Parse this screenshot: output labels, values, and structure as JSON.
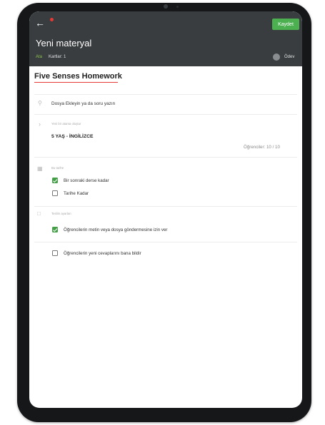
{
  "colors": {
    "appbar": "#393d40",
    "accent": "#4caf50",
    "tab_active": "#8bc34a",
    "red": "#e53935",
    "checked": "#43a047"
  },
  "header": {
    "back_icon": "arrow-left-icon",
    "save_label": "Kaydet",
    "title": "Yeni materyal",
    "tab_active": "Ata",
    "tab_cards": "Kartlar: 1",
    "assignment_label": "Ödev"
  },
  "material": {
    "title": "Five Senses Homework",
    "attach_text": "Dosya Ekleyin ya da soru yazın",
    "group_label": "Yeni bir atama oluştur",
    "group_value": "5 YAŞ - İNGİLİZCE",
    "students": "Öğrenciler: 10 / 10",
    "date_label": "Bu tarihe",
    "date_options": [
      {
        "label": "Bir sonraki derse kadar",
        "checked": true
      },
      {
        "label": "Tarihe Kadar",
        "checked": false
      }
    ],
    "delivery_label": "Teslim ayarları",
    "delivery_options": [
      {
        "label": "Öğrencilerin metin veya dosya göndermesine izin ver",
        "checked": true
      },
      {
        "label": "Öğrencilerin yeni cevaplarını bana bildir",
        "checked": false
      }
    ]
  }
}
